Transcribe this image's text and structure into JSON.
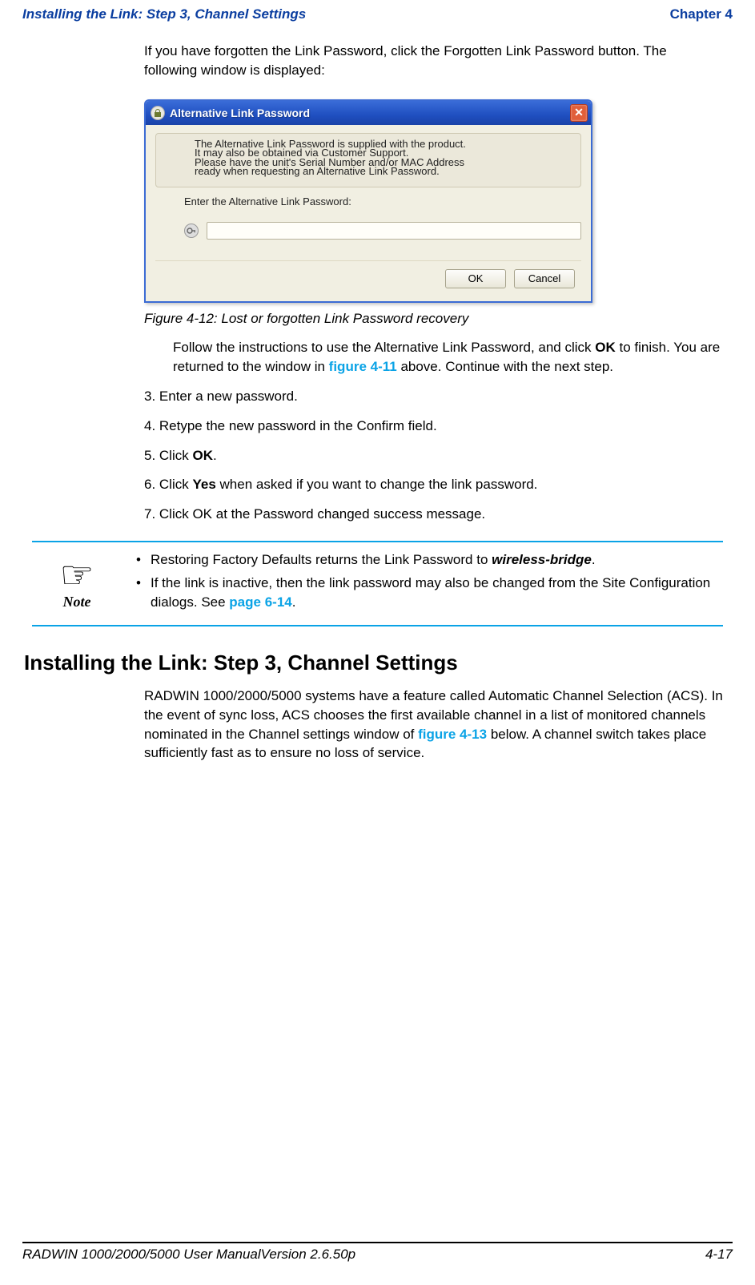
{
  "header": {
    "left": "Installing the Link: Step 3, Channel Settings",
    "right": "Chapter 4"
  },
  "intro": "If you have forgotten the Link Password, click the Forgotten Link Password button. The following window is displayed:",
  "dialog": {
    "title": "Alternative Link Password",
    "info_line1": "The Alternative Link Password is supplied with the product.",
    "info_line2": "It may also be obtained via Customer Support.",
    "info_line3": "Please have the unit's Serial Number and/or MAC Address",
    "info_line4": "ready when requesting an Alternative Link Password.",
    "entry_label": "Enter the Alternative Link Password:",
    "input_value": "",
    "ok_label": "OK",
    "cancel_label": "Cancel"
  },
  "figure_caption": "Figure 4-12: Lost or forgotten Link Password recovery",
  "para_after_fig_pre": "Follow the instructions to use the Alternative Link Password, and click ",
  "para_after_fig_bold1": "OK",
  "para_after_fig_mid": " to finish. You are returned to the window in ",
  "para_after_fig_link": "figure 4-11",
  "para_after_fig_post": " above. Continue with the next step.",
  "steps": {
    "s3": "3. Enter a new password.",
    "s4": "4. Retype the new password in the Confirm field.",
    "s5_pre": "5. Click ",
    "s5_bold": "OK",
    "s5_post": ".",
    "s6_pre": "6. Click ",
    "s6_bold": "Yes",
    "s6_post": " when asked if you want to change the link password.",
    "s7": "7. Click OK at the Password changed success message."
  },
  "note": {
    "label": "Note",
    "b1_pre": "Restoring Factory Defaults returns the Link Password to ",
    "b1_term": "wireless-bridge",
    "b1_post": ".",
    "b2_pre": "If the link is inactive, then the link password may also be changed from the Site Configuration dialogs. See ",
    "b2_link": "page 6-14",
    "b2_post": "."
  },
  "section": {
    "heading": "Installing the Link: Step 3, Channel Settings",
    "para_pre": "RADWIN 1000/2000/5000 systems have a feature called Automatic Channel Selection (ACS). In the event of sync loss, ACS chooses the first available channel in a list of monitored channels nominated in the Channel settings window of ",
    "para_link": "figure 4-13",
    "para_post": " below. A channel switch takes place sufficiently fast as to ensure no loss of service."
  },
  "footer": {
    "left": "RADWIN 1000/2000/5000 User ManualVersion  2.6.50p",
    "right": "4-17"
  }
}
